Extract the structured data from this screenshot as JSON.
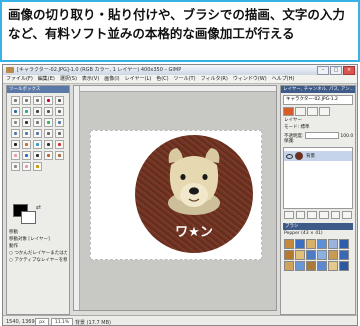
{
  "caption": {
    "text": "画像の切り取り・貼り付けや、ブラシでの描画、文字の入力など、有料ソフト並みの本格的な画像加工が行える"
  },
  "window": {
    "title": "[キャラクター-02.JPG]-1.0 (RGB カラー, 1 レイヤー) 400x350 – GIMP",
    "minimize_label": "–",
    "maximize_label": "□",
    "close_label": "×"
  },
  "menu": {
    "items": [
      "ファイル(F)",
      "編集(E)",
      "選択(S)",
      "表示(V)",
      "画像(I)",
      "レイヤー(L)",
      "色(C)",
      "ツール(T)",
      "フィルタ(R)",
      "ウィンドウ(W)",
      "ヘルプ(H)"
    ]
  },
  "toolbox": {
    "title": "ツールボックス",
    "swap_icon": "⇄",
    "options": [
      "移動",
      "移動対象 [レイヤー]",
      "動作",
      "○ つかんだレイヤーまたはガイド",
      "○ アクティブなレイヤーを移動"
    ]
  },
  "canvas": {
    "image_text": "ワ★ン"
  },
  "status": {
    "coords": "1540, 1369",
    "unit": "px",
    "zoom": "11.1%",
    "info": "背景 (17.7 MB)"
  },
  "layers_panel": {
    "title": "レイヤー, チャンネル, パス, アン...",
    "image_select": "キャラクター-02.JPG-1.2",
    "section_label": "レイヤー",
    "mode_label": "モード:",
    "mode_value": "標準",
    "opacity_label": "不透明度:",
    "opacity_value": "100.0",
    "lock_label": "保護:",
    "layer_name": "背景",
    "brushes_title": "ブラシ",
    "brush_info": "Pepper (43 × 41)"
  },
  "colors": {
    "caption_border": "#37b2e6",
    "panel_title": "#3e5a88",
    "active_tab": "#d85b2a"
  }
}
